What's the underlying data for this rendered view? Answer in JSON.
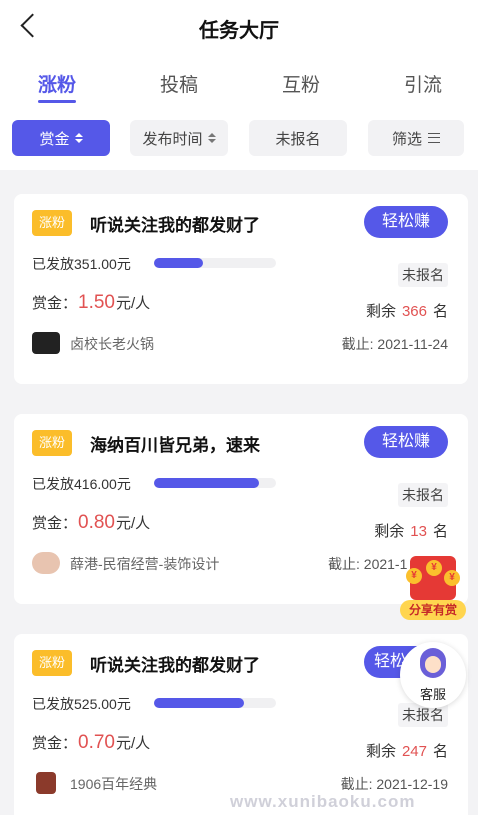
{
  "header": {
    "title": "任务大厅"
  },
  "tabs": [
    {
      "label": "涨粉",
      "active": true
    },
    {
      "label": "投稿",
      "active": false
    },
    {
      "label": "互粉",
      "active": false
    },
    {
      "label": "引流",
      "active": false
    }
  ],
  "filters": [
    {
      "label": "赏金",
      "active": true,
      "icon": "sort-icon"
    },
    {
      "label": "发布时间",
      "active": false,
      "icon": "sort-icon"
    },
    {
      "label": "未报名",
      "active": false,
      "icon": ""
    },
    {
      "label": "筛选",
      "active": false,
      "icon": "menu-icon"
    }
  ],
  "tasks": [
    {
      "badge": "涨粉",
      "title": "听说关注我的都发财了",
      "button": "轻松赚",
      "issued": "已发放351.00元",
      "progress": 0.4,
      "status": "未报名",
      "reward_label": "赏金：",
      "reward": "1.50",
      "reward_unit": "元/人",
      "remain_label": "剩余",
      "remain": "366",
      "remain_unit": "名",
      "creator": "卤校长老火锅",
      "deadline": "截止: 2021-11-24",
      "avatar_color": "#222222"
    },
    {
      "badge": "涨粉",
      "title": "海纳百川皆兄弟，速来",
      "button": "轻松赚",
      "issued": "已发放416.00元",
      "progress": 0.86,
      "status": "未报名",
      "reward_label": "赏金：",
      "reward": "0.80",
      "reward_unit": "元/人",
      "remain_label": "剩余",
      "remain": "13",
      "remain_unit": "名",
      "creator": "薛港-民宿经营-装饰设计",
      "deadline": "截止: 2021-1",
      "avatar_color": "#e8c4b0"
    },
    {
      "badge": "涨粉",
      "title": "听说关注我的都发财了",
      "button": "轻松",
      "issued": "已发放525.00元",
      "progress": 0.74,
      "status": "未报名",
      "reward_label": "赏金：",
      "reward": "0.70",
      "reward_unit": "元/人",
      "remain_label": "剩余",
      "remain": "247",
      "remain_unit": "名",
      "creator": "1906百年经典",
      "deadline": "截止: 2021-12-19",
      "avatar_color": "#8b3a2b"
    }
  ],
  "floating": {
    "share_label": "分享有赏",
    "service_label": "客服"
  },
  "watermark": "www.xunibaoku.com",
  "colors": {
    "accent": "#5558e8",
    "badge": "#fbbd2a",
    "price": "#e15252"
  }
}
